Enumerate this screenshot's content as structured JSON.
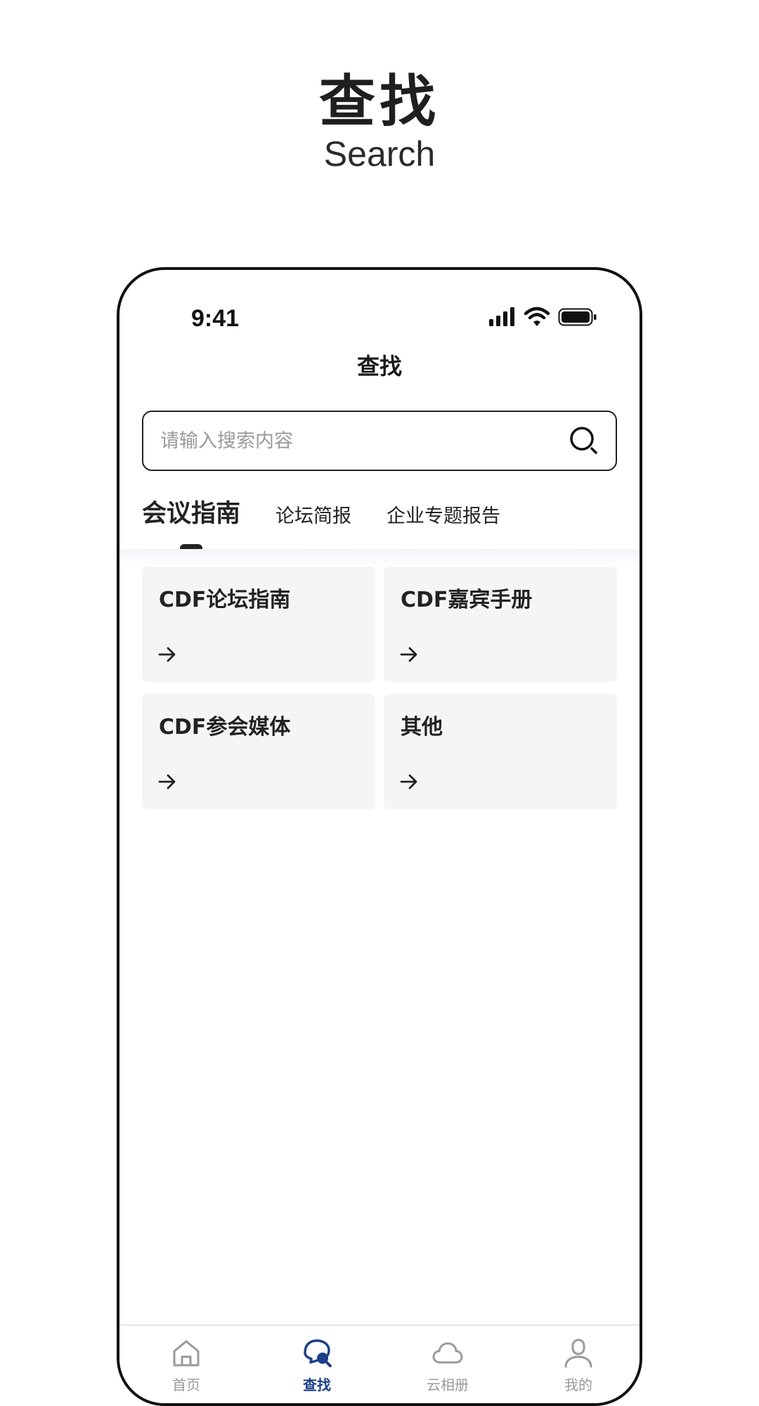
{
  "hero": {
    "title": "查找",
    "subtitle": "Search"
  },
  "status_bar": {
    "time": "9:41"
  },
  "nav": {
    "title": "查找"
  },
  "search": {
    "placeholder": "请输入搜索内容",
    "value": ""
  },
  "tabs": [
    {
      "label": "会议指南",
      "active": true
    },
    {
      "label": "论坛简报",
      "active": false
    },
    {
      "label": "企业专题报告",
      "active": false
    }
  ],
  "cards": [
    {
      "title": "CDF论坛指南"
    },
    {
      "title": "CDF嘉宾手册"
    },
    {
      "title": "CDF参会媒体"
    },
    {
      "title": "其他"
    }
  ],
  "tabbar": [
    {
      "label": "首页",
      "icon": "home-icon",
      "active": false
    },
    {
      "label": "查找",
      "icon": "search-tab-icon",
      "active": true
    },
    {
      "label": "云相册",
      "icon": "cloud-icon",
      "active": false
    },
    {
      "label": "我的",
      "icon": "user-icon",
      "active": false
    }
  ],
  "colors": {
    "accent": "#1c3f8a",
    "card_bg": "#f5f5f5",
    "inactive": "#9a9a9a"
  }
}
